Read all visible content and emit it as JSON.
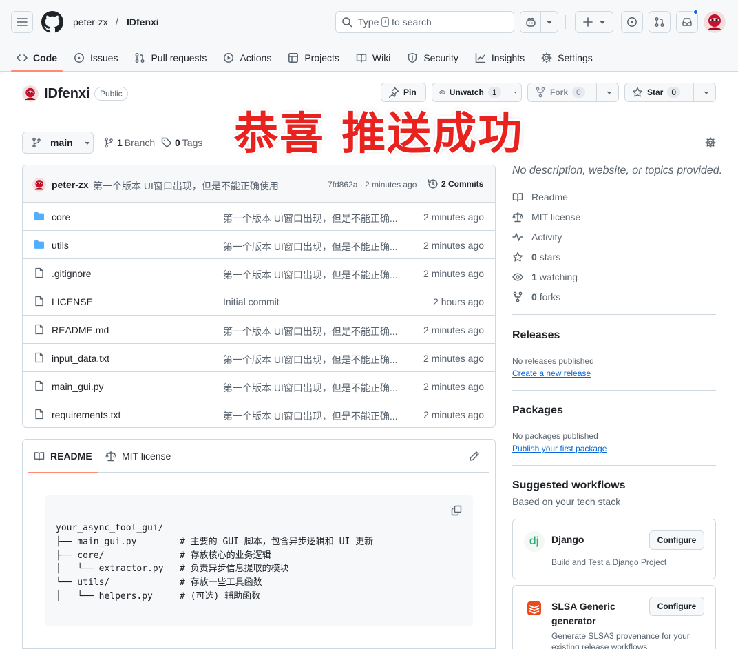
{
  "colors": {
    "accent": "#fd8c73",
    "link": "#0969da",
    "overlay": "#e8221e"
  },
  "header": {
    "owner": "peter-zx",
    "separator": "/",
    "repo": "IDfenxi",
    "search_prefix": "Type",
    "search_key": "/",
    "search_suffix": "to search"
  },
  "tabs": [
    {
      "label": "Code",
      "icon": "code-icon"
    },
    {
      "label": "Issues",
      "icon": "issue-icon"
    },
    {
      "label": "Pull requests",
      "icon": "pull-request-icon"
    },
    {
      "label": "Actions",
      "icon": "play-icon"
    },
    {
      "label": "Projects",
      "icon": "table-icon"
    },
    {
      "label": "Wiki",
      "icon": "book-icon"
    },
    {
      "label": "Security",
      "icon": "shield-icon"
    },
    {
      "label": "Insights",
      "icon": "graph-icon"
    },
    {
      "label": "Settings",
      "icon": "gear-icon"
    }
  ],
  "repo": {
    "name": "IDfenxi",
    "visibility": "Public",
    "pin": "Pin",
    "unwatch": "Unwatch",
    "watch_count": "1",
    "fork": "Fork",
    "fork_count": "0",
    "star": "Star",
    "star_count": "0"
  },
  "branch": {
    "name": "main",
    "branch_count": "1",
    "branch_label": "Branch",
    "tag_count": "0",
    "tag_label": "Tags"
  },
  "commit": {
    "author": "peter-zx",
    "message": "第一个版本 UI窗口出现，但是不能正确使用",
    "hash_time": "7fd862a · 2 minutes ago",
    "count": "2 Commits"
  },
  "files": [
    {
      "name": "core",
      "type": "folder",
      "message": "第一个版本 UI窗口出现，但是不能正确...",
      "time": "2 minutes ago"
    },
    {
      "name": "utils",
      "type": "folder",
      "message": "第一个版本 UI窗口出现，但是不能正确...",
      "time": "2 minutes ago"
    },
    {
      "name": ".gitignore",
      "type": "file",
      "message": "第一个版本 UI窗口出现，但是不能正确...",
      "time": "2 minutes ago"
    },
    {
      "name": "LICENSE",
      "type": "file",
      "message": "Initial commit",
      "time": "2 hours ago"
    },
    {
      "name": "README.md",
      "type": "file",
      "message": "第一个版本 UI窗口出现，但是不能正确...",
      "time": "2 minutes ago"
    },
    {
      "name": "input_data.txt",
      "type": "file",
      "message": "第一个版本 UI窗口出现，但是不能正确...",
      "time": "2 minutes ago"
    },
    {
      "name": "main_gui.py",
      "type": "file",
      "message": "第一个版本 UI窗口出现，但是不能正确...",
      "time": "2 minutes ago"
    },
    {
      "name": "requirements.txt",
      "type": "file",
      "message": "第一个版本 UI窗口出现，但是不能正确...",
      "time": "2 minutes ago"
    }
  ],
  "readme": {
    "tab_readme": "README",
    "tab_license": "MIT license",
    "code": "your_async_tool_gui/\n├── main_gui.py        # 主要的 GUI 脚本，包含异步逻辑和 UI 更新\n├── core/              # 存放核心的业务逻辑\n│   └── extractor.py   # 负责异步信息提取的模块\n└── utils/             # 存放一些工具函数\n│   └── helpers.py     # (可选) 辅助函数"
  },
  "about": {
    "description": "No description, website, or topics provided.",
    "readme": "Readme",
    "license": "MIT license",
    "activity": "Activity",
    "stars_count": "0",
    "stars_label": "stars",
    "watching_count": "1",
    "watching_label": "watching",
    "forks_count": "0",
    "forks_label": "forks"
  },
  "releases": {
    "title": "Releases",
    "empty": "No releases published",
    "link": "Create a new release"
  },
  "packages": {
    "title": "Packages",
    "empty": "No packages published",
    "link": "Publish your first package"
  },
  "workflows": {
    "title": "Suggested workflows",
    "subtitle": "Based on your tech stack",
    "items": [
      {
        "name": "Django",
        "logo_text": "dj",
        "description": "Build and Test a Django Project",
        "button": "Configure"
      },
      {
        "name": "SLSA Generic generator",
        "description": "Generate SLSA3 provenance for your existing release workflows",
        "button": "Configure"
      }
    ]
  },
  "overlay_text": "恭喜 推送成功"
}
